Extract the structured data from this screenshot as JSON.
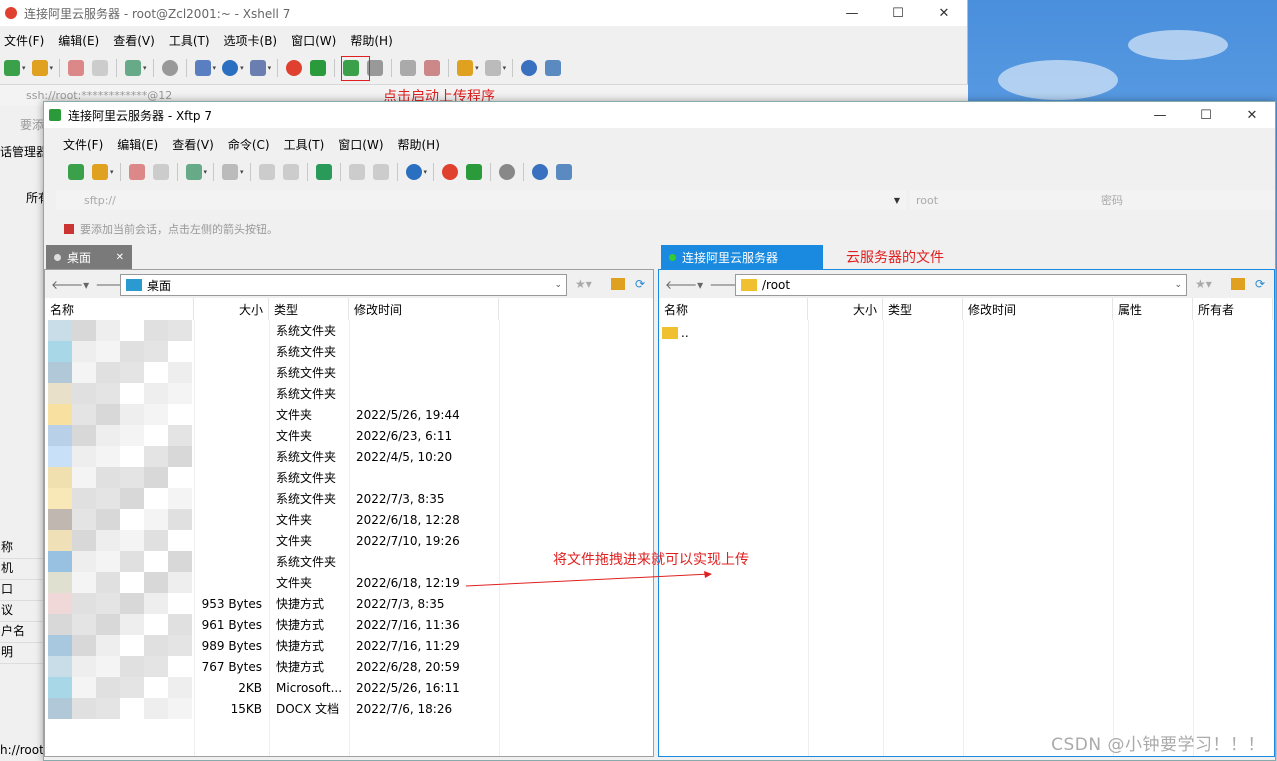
{
  "xshell": {
    "title": "连接阿里云服务器 - root@Zcl2001:~ - Xshell 7",
    "menu": [
      "文件(F)",
      "编辑(E)",
      "查看(V)",
      "工具(T)",
      "选项卡(B)",
      "窗口(W)",
      "帮助(H)"
    ],
    "address": "ssh://root:************@12",
    "side_fragments": {
      "hint": "要添",
      "session_manager": "话管理器",
      "all": "所有",
      "props": [
        "称",
        "机",
        "口",
        "议",
        "户名",
        "明"
      ],
      "status": "h://root"
    }
  },
  "xftp": {
    "title": "连接阿里云服务器 - Xftp 7",
    "menu": [
      "文件(F)",
      "编辑(E)",
      "查看(V)",
      "命令(C)",
      "工具(T)",
      "窗口(W)",
      "帮助(H)"
    ],
    "sftp_address": "sftp://",
    "user": "root",
    "password_placeholder": "密码",
    "hint": "要添加当前会话，点击左侧的箭头按钮。",
    "left_tab": "桌面",
    "right_tab": "连接阿里云服务器",
    "left_path": "桌面",
    "right_path": "/root",
    "left_columns": [
      "名称",
      "大小",
      "类型",
      "修改时间"
    ],
    "right_columns": [
      "名称",
      "大小",
      "类型",
      "修改时间",
      "属性",
      "所有者"
    ],
    "left_rows": [
      {
        "size": "",
        "type": "系统文件夹",
        "modified": ""
      },
      {
        "size": "",
        "type": "系统文件夹",
        "modified": ""
      },
      {
        "size": "",
        "type": "系统文件夹",
        "modified": ""
      },
      {
        "size": "",
        "type": "系统文件夹",
        "modified": ""
      },
      {
        "size": "",
        "type": "文件夹",
        "modified": "2022/5/26, 19:44"
      },
      {
        "size": "",
        "type": "文件夹",
        "modified": "2022/6/23, 6:11"
      },
      {
        "size": "",
        "type": "系统文件夹",
        "modified": "2022/4/5, 10:20"
      },
      {
        "size": "",
        "type": "系统文件夹",
        "modified": ""
      },
      {
        "size": "",
        "type": "系统文件夹",
        "modified": "2022/7/3, 8:35"
      },
      {
        "size": "",
        "type": "文件夹",
        "modified": "2022/6/18, 12:28"
      },
      {
        "size": "",
        "type": "文件夹",
        "modified": "2022/7/10, 19:26"
      },
      {
        "size": "",
        "type": "系统文件夹",
        "modified": ""
      },
      {
        "size": "",
        "type": "文件夹",
        "modified": "2022/6/18, 12:19"
      },
      {
        "size": "953 Bytes",
        "type": "快捷方式",
        "modified": "2022/7/3, 8:35"
      },
      {
        "size": "961 Bytes",
        "type": "快捷方式",
        "modified": "2022/7/16, 11:36"
      },
      {
        "size": "989 Bytes",
        "type": "快捷方式",
        "modified": "2022/7/16, 11:29"
      },
      {
        "size": "767 Bytes",
        "type": "快捷方式",
        "modified": "2022/6/28, 20:59"
      },
      {
        "size": "2KB",
        "type": "Microsoft...",
        "modified": "2022/5/26, 16:11"
      },
      {
        "size": "15KB",
        "type": "DOCX 文档",
        "modified": "2022/7/6, 18:26"
      }
    ],
    "right_rows": [
      {
        "name": ".."
      }
    ]
  },
  "annotations": {
    "start_upload": "点击启动上传程序",
    "server_files": "云服务器的文件",
    "drag_hint": "将文件拖拽进来就可以实现上传"
  },
  "watermark": "CSDN @小钟要学习！！！"
}
